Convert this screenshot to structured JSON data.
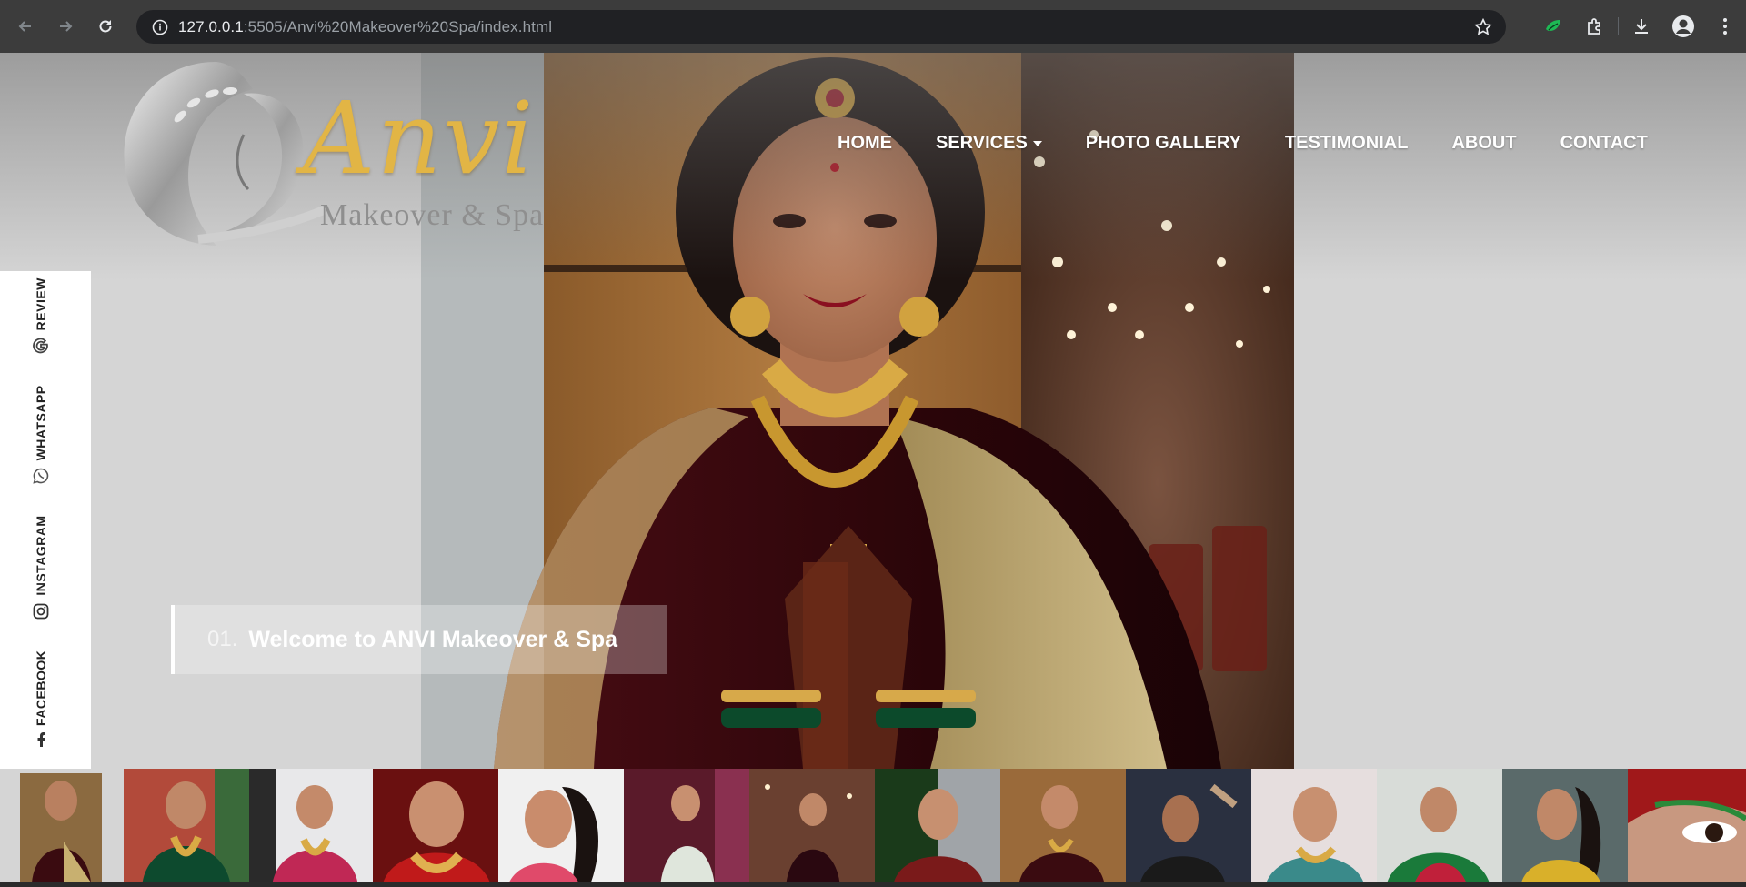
{
  "browser": {
    "url_host": "127.0.0.1",
    "url_rest": ":5505/Anvi%20Makeover%20Spa/index.html",
    "icons": [
      "back-icon",
      "forward-icon",
      "reload-icon",
      "site-info-icon",
      "bookmark-star-icon",
      "extension-leaf-icon",
      "extensions-icon",
      "download-icon",
      "profile-icon",
      "menu-icon"
    ]
  },
  "logo": {
    "word": "Anvi",
    "sub": "Makeover & Spa"
  },
  "nav": {
    "items": [
      {
        "label": "HOME"
      },
      {
        "label": "SERVICES"
      },
      {
        "label": "PHOTO GALLERY"
      },
      {
        "label": "TESTIMONIAL"
      },
      {
        "label": "ABOUT"
      },
      {
        "label": "CONTACT"
      }
    ]
  },
  "social": {
    "items": [
      {
        "label": "FACEBOOK",
        "icon": "facebook-icon"
      },
      {
        "label": "INSTAGRAM",
        "icon": "instagram-icon"
      },
      {
        "label": "WHATSAPP",
        "icon": "whatsapp-icon"
      },
      {
        "label": "REVIEW",
        "icon": "google-icon"
      }
    ]
  },
  "slide": {
    "number": "01.",
    "title": "Welcome to ANVI Makeover & Spa"
  },
  "colors": {
    "gold": "#e2b545",
    "page_bg": "#d5d5d5",
    "chrome_bg": "#3c3c3c"
  }
}
